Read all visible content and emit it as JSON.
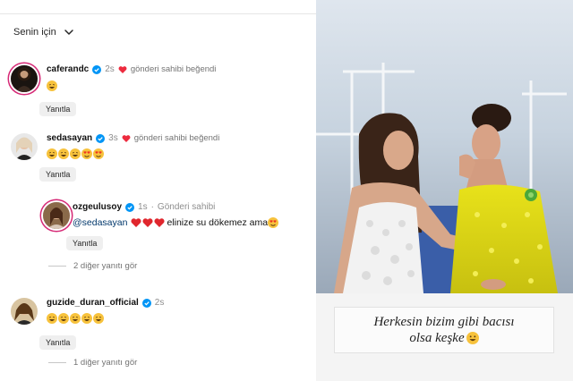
{
  "filter": {
    "label": "Senin için"
  },
  "comments": [
    {
      "username": "caferandc",
      "time": "2s",
      "liked_text": "gönderi sahibi beğendi",
      "reply_label": "Yanıtla"
    },
    {
      "username": "sedasayan",
      "time": "3s",
      "liked_text": "gönderi sahibi beğendi",
      "reply_label": "Yanıtla"
    },
    {
      "username": "guzide_duran_official",
      "time": "2s",
      "reply_label": "Yanıtla",
      "view_more": "1 diğer yanıtı gör"
    }
  ],
  "reply": {
    "username": "ozgeulusoy",
    "time": "1s",
    "role": "Gönderi sahibi",
    "mention": "@sedasayan",
    "text": "elinize su dökemez ama",
    "reply_label": "Yanıtla",
    "view_more": "2 diğer yanıtı gör"
  },
  "photo_caption": {
    "line1": "Herkesin bizim gibi bacısı",
    "line2": "olsa keşke"
  },
  "colors": {
    "verified": "#0095f6",
    "heart": "#ed2b3e",
    "mention": "#00376b",
    "emoji": "#f7c23c"
  }
}
